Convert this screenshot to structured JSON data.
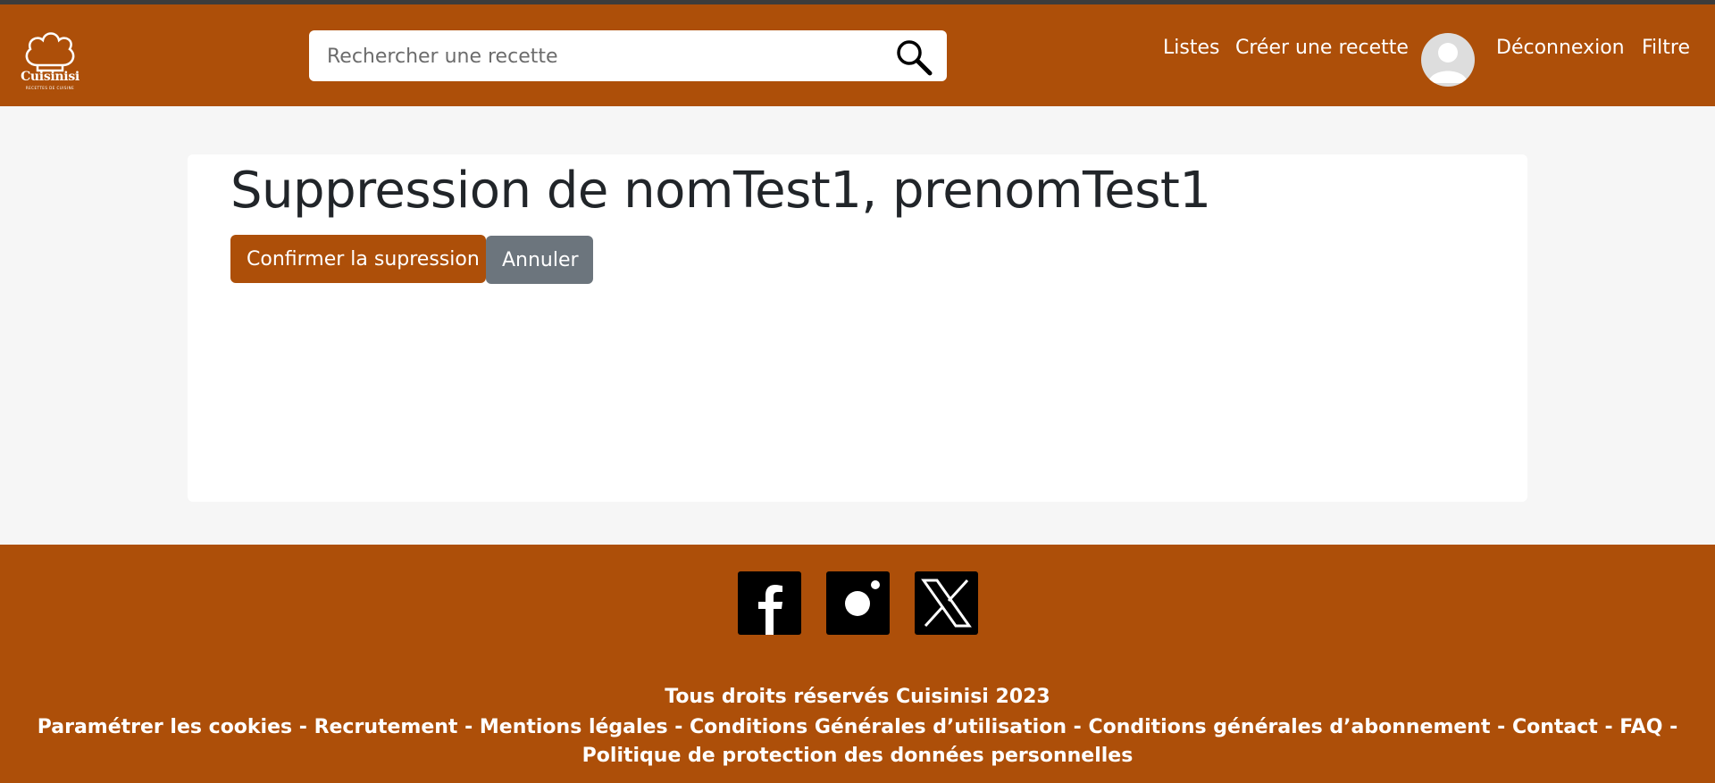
{
  "header": {
    "logo": {
      "brand": "Cuisinisi",
      "tagline": "RECETTES DE CUISINE"
    },
    "search": {
      "placeholder": "Rechercher une recette",
      "value": "",
      "icon": "search-icon"
    },
    "nav": {
      "lists": "Listes",
      "create_recipe": "Créer une recette",
      "logout": "Déconnexion",
      "filter": "Filtre"
    },
    "avatar_icon": "user-avatar-icon"
  },
  "main": {
    "title": "Suppression de nomTest1, prenomTest1",
    "confirm_label": "Confirmer la supression",
    "cancel_label": "Annuler"
  },
  "footer": {
    "social": [
      "facebook-icon",
      "instagram-icon",
      "x-icon"
    ],
    "copyright": "Tous droits réservés Cuisinisi 2023",
    "links": [
      "Paramétrer les cookies",
      "Recrutement",
      "Mentions légales",
      "Conditions Générales d’utilisation",
      "Conditions générales d’abonnement",
      "Contact",
      "FAQ",
      "Politique de protection des données personnelles"
    ],
    "separator": " - "
  },
  "colors": {
    "brand": "#ad4f09",
    "secondary": "#6c757d",
    "background": "#f6f6f6"
  }
}
